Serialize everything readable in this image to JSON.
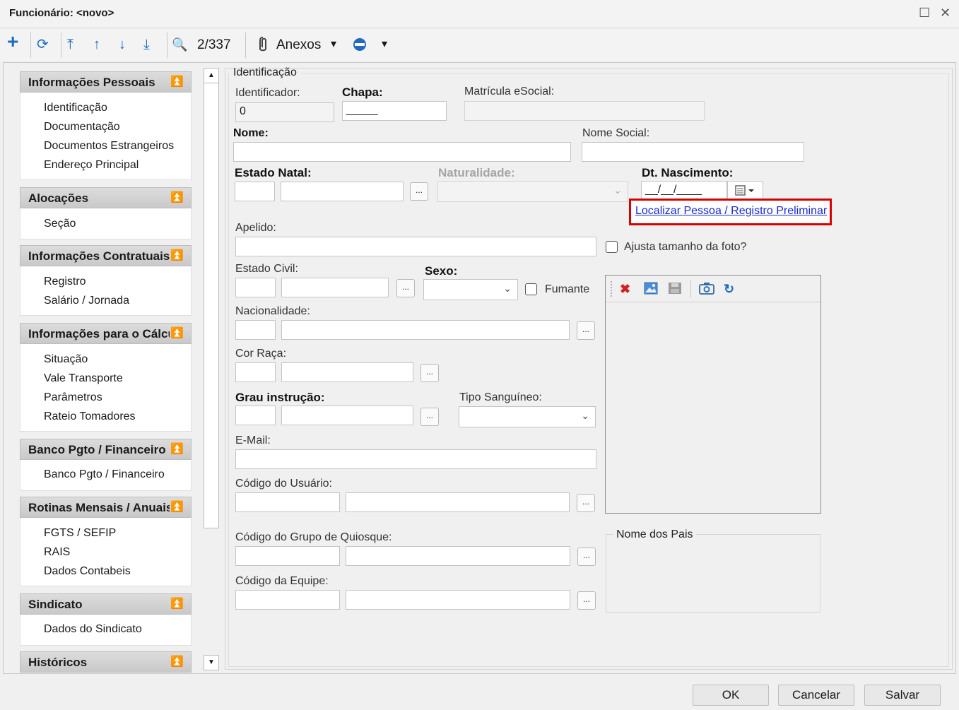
{
  "window": {
    "title": "Funcionário: <novo>",
    "maximize_glyph": "☐",
    "close_glyph": "✕"
  },
  "toolbar": {
    "add_icon": "+",
    "refresh_icon": "⟳",
    "first_icon": "⤒",
    "prev_icon": "↑",
    "next_icon": "↓",
    "last_icon": "⤓",
    "search_icon": "🔍",
    "record_position": "2/337",
    "attachments_label": "Anexos",
    "dropdown_glyph": "▾",
    "extra_icon": "⊜"
  },
  "sidebar": {
    "sections": [
      {
        "title": "Informações Pessoais",
        "items": [
          "Identificação",
          "Documentação",
          "Documentos Estrangeiros",
          "Endereço Principal"
        ]
      },
      {
        "title": "Alocações",
        "items": [
          "Seção"
        ]
      },
      {
        "title": "Informações Contratuais",
        "items": [
          "Registro",
          "Salário / Jornada"
        ]
      },
      {
        "title": "Informações para o Cálculo",
        "items": [
          "Situação",
          "Vale Transporte",
          "Parâmetros",
          "Rateio Tomadores"
        ]
      },
      {
        "title": "Banco Pgto / Financeiro",
        "items": [
          "Banco Pgto / Financeiro"
        ]
      },
      {
        "title": "Rotinas Mensais / Anuais",
        "items": [
          "FGTS / SEFIP",
          "RAIS",
          "Dados Contabeis"
        ]
      },
      {
        "title": "Sindicato",
        "items": [
          "Dados do Sindicato"
        ]
      },
      {
        "title": "Históricos",
        "items": []
      }
    ],
    "collapse_glyph": "⌃"
  },
  "form": {
    "group_title": "Identificação",
    "identificador": {
      "label": "Identificador:",
      "value": "0"
    },
    "chapa": {
      "label": "Chapa:",
      "value": "_____"
    },
    "matricula": {
      "label": "Matrícula eSocial:",
      "value": ""
    },
    "nome": {
      "label": "Nome:",
      "value": ""
    },
    "nome_social": {
      "label": "Nome Social:",
      "value": ""
    },
    "estado_natal": {
      "label": "Estado Natal:"
    },
    "naturalidade": {
      "label": "Naturalidade:"
    },
    "dt_nascimento": {
      "label": "Dt. Nascimento:",
      "value": "__/__/____"
    },
    "localizar_link": "Localizar Pessoa / Registro Preliminar",
    "apelido": {
      "label": "Apelido:"
    },
    "ajusta_foto": "Ajusta tamanho da foto?",
    "estado_civil": {
      "label": "Estado Civil:"
    },
    "sexo": {
      "label": "Sexo:"
    },
    "fumante": "Fumante",
    "nacionalidade": {
      "label": "Nacionalidade:"
    },
    "cor_raca": {
      "label": "Cor Raça:"
    },
    "grau_instrucao": {
      "label": "Grau instrução:"
    },
    "tipo_sanguineo": {
      "label": "Tipo Sanguíneo:"
    },
    "email": {
      "label": "E-Mail:"
    },
    "codigo_usuario": {
      "label": "Código do Usuário:"
    },
    "codigo_quiosque": {
      "label": "Código do Grupo de Quiosque:"
    },
    "codigo_equipe": {
      "label": "Código da Equipe:"
    },
    "nome_pais": "Nome dos Pais",
    "ellipsis": "...",
    "select_glyph": "⌄"
  },
  "photo_toolbar": {
    "delete_icon": "✖",
    "image_icon": "🖼",
    "save_icon": "💾",
    "camera_icon": "📷",
    "rotate_icon": "↻"
  },
  "buttons": {
    "ok": "OK",
    "cancel": "Cancelar",
    "save": "Salvar"
  },
  "colors": {
    "accent_blue": "#1f6cc2",
    "highlight_red": "#d60000",
    "link_blue": "#1a2ad0"
  }
}
